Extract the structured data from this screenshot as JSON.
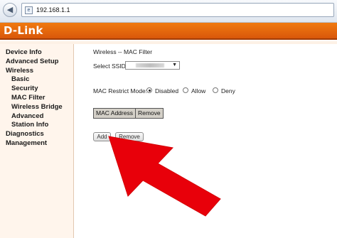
{
  "browser": {
    "url": "192.168.1.1"
  },
  "header": {
    "logo": "D-Link",
    "brand_color": "#e8680d"
  },
  "sidebar": {
    "items": [
      {
        "label": "Device Info",
        "level": 0
      },
      {
        "label": "Advanced Setup",
        "level": 0
      },
      {
        "label": "Wireless",
        "level": 0
      },
      {
        "label": "Basic",
        "level": 1
      },
      {
        "label": "Security",
        "level": 1
      },
      {
        "label": "MAC Filter",
        "level": 1
      },
      {
        "label": "Wireless Bridge",
        "level": 1
      },
      {
        "label": "Advanced",
        "level": 1
      },
      {
        "label": "Station Info",
        "level": 1
      },
      {
        "label": "Diagnostics",
        "level": 0
      },
      {
        "label": "Management",
        "level": 0
      }
    ]
  },
  "main": {
    "title": "Wireless -- MAC Filter",
    "ssid_label": "Select SSID:",
    "restrict_label": "MAC Restrict Mode:",
    "modes": [
      {
        "label": "Disabled",
        "selected": true
      },
      {
        "label": "Allow",
        "selected": false
      },
      {
        "label": "Deny",
        "selected": false
      }
    ],
    "table_headers": [
      "MAC Address",
      "Remove"
    ],
    "add_label": "Add",
    "remove_label": "Remove"
  },
  "overlay": {
    "arrow_color": "#e8000a",
    "arrow_icon": "red-arrow-icon"
  }
}
